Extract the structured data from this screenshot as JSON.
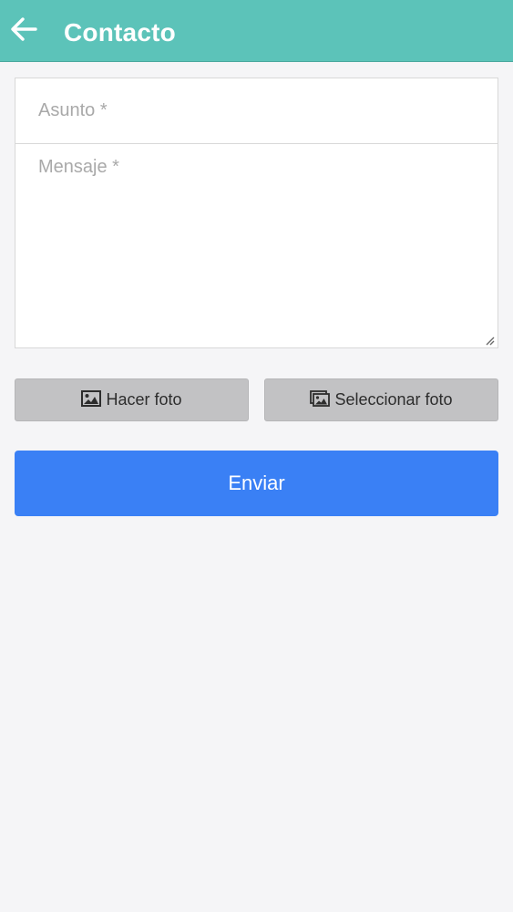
{
  "header": {
    "title": "Contacto",
    "back_icon": "arrow-left-icon",
    "background_color": "#5cc3b9"
  },
  "form": {
    "subject_placeholder": "Asunto *",
    "subject_value": "",
    "message_placeholder": "Mensaje *",
    "message_value": ""
  },
  "actions": {
    "take_photo_label": "Hacer foto",
    "take_photo_icon": "image-icon",
    "select_photo_label": "Seleccionar foto",
    "select_photo_icon": "images-icon",
    "send_label": "Enviar",
    "send_color": "#3a80f5"
  }
}
